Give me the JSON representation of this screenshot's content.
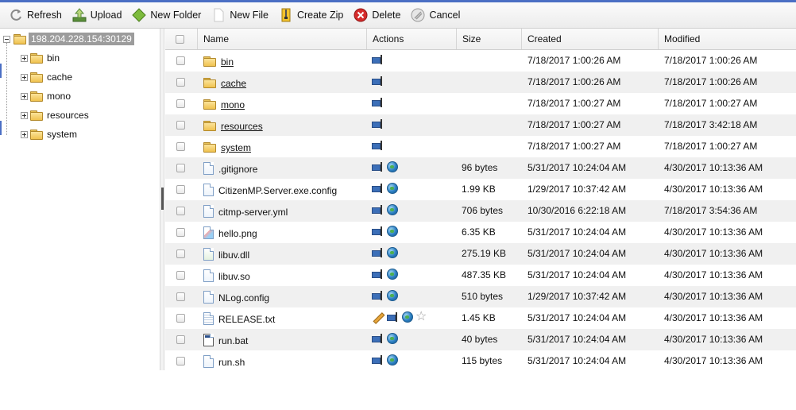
{
  "toolbar": {
    "refresh": "Refresh",
    "upload": "Upload",
    "new_folder": "New Folder",
    "new_file": "New File",
    "create_zip": "Create Zip",
    "delete": "Delete",
    "cancel": "Cancel"
  },
  "tree": {
    "root": "198.204.228.154:30129",
    "items": [
      "bin",
      "cache",
      "mono",
      "resources",
      "system"
    ]
  },
  "grid": {
    "columns": {
      "name": "Name",
      "actions": "Actions",
      "size": "Size",
      "created": "Created",
      "modified": "Modified"
    },
    "rows": [
      {
        "name": "bin",
        "type": "folder",
        "actions": [
          "rename"
        ],
        "size": "",
        "created": "7/18/2017 1:00:26 AM",
        "modified": "7/18/2017 1:00:26 AM"
      },
      {
        "name": "cache",
        "type": "folder",
        "actions": [
          "rename"
        ],
        "size": "",
        "created": "7/18/2017 1:00:26 AM",
        "modified": "7/18/2017 1:00:26 AM"
      },
      {
        "name": "mono",
        "type": "folder",
        "actions": [
          "rename"
        ],
        "size": "",
        "created": "7/18/2017 1:00:27 AM",
        "modified": "7/18/2017 1:00:27 AM"
      },
      {
        "name": "resources",
        "type": "folder",
        "actions": [
          "rename"
        ],
        "size": "",
        "created": "7/18/2017 1:00:27 AM",
        "modified": "7/18/2017 3:42:18 AM"
      },
      {
        "name": "system",
        "type": "folder",
        "actions": [
          "rename"
        ],
        "size": "",
        "created": "7/18/2017 1:00:27 AM",
        "modified": "7/18/2017 1:00:27 AM"
      },
      {
        "name": ".gitignore",
        "type": "file",
        "actions": [
          "rename",
          "globe"
        ],
        "size": "96 bytes",
        "created": "5/31/2017 10:24:04 AM",
        "modified": "4/30/2017 10:13:36 AM"
      },
      {
        "name": "CitizenMP.Server.exe.config",
        "type": "file",
        "actions": [
          "rename",
          "globe"
        ],
        "size": "1.99 KB",
        "created": "1/29/2017 10:37:42 AM",
        "modified": "4/30/2017 10:13:36 AM"
      },
      {
        "name": "citmp-server.yml",
        "type": "file",
        "actions": [
          "rename",
          "globe"
        ],
        "size": "706 bytes",
        "created": "10/30/2016 6:22:18 AM",
        "modified": "7/18/2017 3:54:36 AM"
      },
      {
        "name": "hello.png",
        "type": "png",
        "actions": [
          "rename",
          "globe"
        ],
        "size": "6.35 KB",
        "created": "5/31/2017 10:24:04 AM",
        "modified": "4/30/2017 10:13:36 AM"
      },
      {
        "name": "libuv.dll",
        "type": "dll",
        "actions": [
          "rename",
          "globe"
        ],
        "size": "275.19 KB",
        "created": "5/31/2017 10:24:04 AM",
        "modified": "4/30/2017 10:13:36 AM"
      },
      {
        "name": "libuv.so",
        "type": "file",
        "actions": [
          "rename",
          "globe"
        ],
        "size": "487.35 KB",
        "created": "5/31/2017 10:24:04 AM",
        "modified": "4/30/2017 10:13:36 AM"
      },
      {
        "name": "NLog.config",
        "type": "file",
        "actions": [
          "rename",
          "globe"
        ],
        "size": "510 bytes",
        "created": "1/29/2017 10:37:42 AM",
        "modified": "4/30/2017 10:13:36 AM"
      },
      {
        "name": "RELEASE.txt",
        "type": "txt",
        "actions": [
          "edit",
          "rename",
          "globe",
          "favorite"
        ],
        "size": "1.45 KB",
        "created": "5/31/2017 10:24:04 AM",
        "modified": "4/30/2017 10:13:36 AM"
      },
      {
        "name": "run.bat",
        "type": "bat",
        "actions": [
          "rename",
          "globe"
        ],
        "size": "40 bytes",
        "created": "5/31/2017 10:24:04 AM",
        "modified": "4/30/2017 10:13:36 AM"
      },
      {
        "name": "run.sh",
        "type": "file",
        "actions": [
          "rename",
          "globe"
        ],
        "size": "115 bytes",
        "created": "5/31/2017 10:24:04 AM",
        "modified": "4/30/2017 10:13:36 AM"
      }
    ]
  },
  "colors": {
    "accent": "#4b6fc4",
    "row_alt": "#f0f0f0",
    "folder": "#f0c24f",
    "delete_red": "#d62b2b"
  }
}
